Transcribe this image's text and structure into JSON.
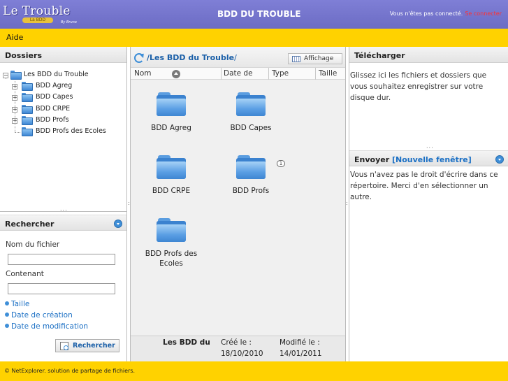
{
  "header": {
    "logo_text": "Le Trouble",
    "logo_badge": "La BDD",
    "logo_sub": "By Bruno",
    "app_title": "BDD DU TROUBLE",
    "login_status": "Vous n'êtes pas connecté.",
    "login_link": "Se connecter"
  },
  "menu": {
    "aide": "Aide"
  },
  "folders_panel": {
    "title": "Dossiers",
    "tree": [
      {
        "label": "Les BDD du Trouble",
        "level": 0
      },
      {
        "label": "BDD Agreg",
        "level": 1
      },
      {
        "label": "BDD Capes",
        "level": 1
      },
      {
        "label": "BDD CRPE",
        "level": 1
      },
      {
        "label": "BDD Profs",
        "level": 1
      },
      {
        "label": "BDD Profs des Ecoles",
        "level": 1
      }
    ]
  },
  "search_panel": {
    "title": "Rechercher",
    "filename_label": "Nom du fichier",
    "filename_value": "",
    "content_label": "Contenant",
    "content_value": "",
    "options": [
      "Taille",
      "Date de création",
      "Date de modification"
    ],
    "button": "Rechercher"
  },
  "browser": {
    "path": "/Les BDD du Trouble",
    "path_tail": "/",
    "view_button": "Affichage",
    "columns": [
      "Nom",
      "Date de",
      "Type",
      "Taille"
    ],
    "items": [
      {
        "label": "BDD Agreg"
      },
      {
        "label": "BDD Capes"
      },
      {
        "label": "BDD CRPE"
      },
      {
        "label": "BDD Profs",
        "comment_count": "1"
      },
      {
        "label": "BDD Profs des Ecoles"
      }
    ],
    "info": {
      "name": "Les BDD du",
      "created_label": "Créé le :",
      "created_value": "18/10/2010",
      "modified_label": "Modifié le :",
      "modified_value": "14/01/2011"
    }
  },
  "download_panel": {
    "title": "Télécharger",
    "text": "Glissez ici les fichiers et dossiers que vous souhaitez enregistrer sur votre disque dur."
  },
  "upload_panel": {
    "title": "Envoyer",
    "new_window_link": "[Nouvelle fenêtre]",
    "text": "Vous n'avez pas le droit d'écrire dans ce répertoire. Merci d'en sélectionner un autre."
  },
  "footer": {
    "text": "© NetExplorer. solution de partage de fichiers."
  },
  "colors": {
    "header": "#7373cc",
    "accent_bar": "#ffd200",
    "link": "#1a6fc4"
  }
}
